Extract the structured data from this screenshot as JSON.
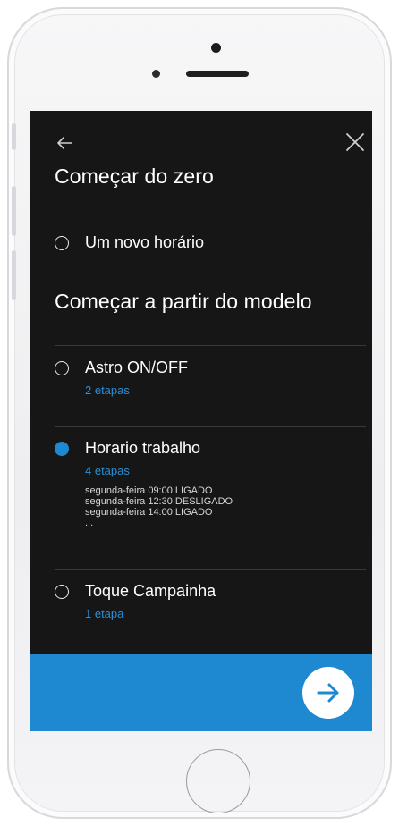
{
  "header": {
    "title_from_scratch": "Começar do zero",
    "title_from_template": "Começar a partir do modelo"
  },
  "new_schedule_option": {
    "label": "Um novo horário",
    "selected": false
  },
  "templates": [
    {
      "title": "Astro ON/OFF",
      "steps": "2 etapas",
      "selected": false,
      "details": []
    },
    {
      "title": "Horario trabalho",
      "steps": "4 etapas",
      "selected": true,
      "details": [
        "segunda-feira 09:00 LIGADO",
        "segunda-feira 12:30 DESLIGADO",
        "segunda-feira 14:00 LIGADO",
        "..."
      ]
    },
    {
      "title": "Toque Campainha",
      "steps": "1 etapa",
      "selected": false,
      "details": []
    }
  ],
  "icons": {
    "back": "arrow-left-icon",
    "close": "close-icon",
    "next": "arrow-right-icon"
  },
  "colors": {
    "background": "#161616",
    "accent": "#1e88d0",
    "link": "#2a8fd6",
    "text": "#ffffff"
  }
}
